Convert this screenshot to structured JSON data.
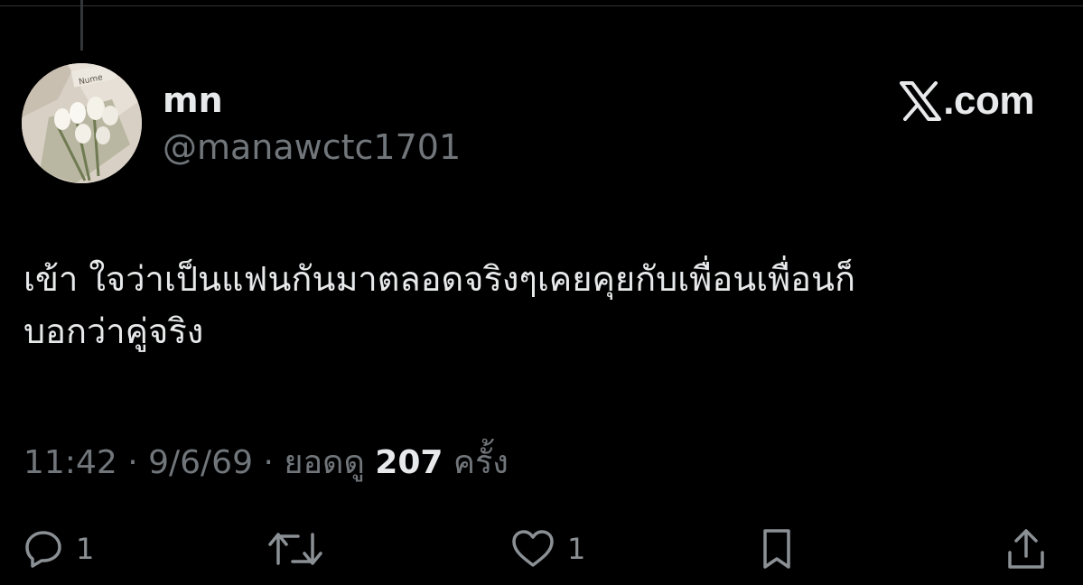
{
  "tweet": {
    "display_name": "mn",
    "handle": "@manawctc1701",
    "brand_text": ".com",
    "text_lines": [
      "เข้า ใจว่าเป็นแฟนกันมาตลอดจริงๆเคยคุยกับเพื่อนเพื่อนก็",
      "บอกว่าคู่จริง"
    ],
    "time": "11:42",
    "separator1": "·",
    "date": "9/6/69",
    "separator2": "·",
    "views_label": "ยอดดู",
    "views_count": "207",
    "views_suffix": "ครั้ง",
    "avatar_label": "Nume",
    "replies_count": "1",
    "likes_count": "1"
  },
  "icons": {
    "brand": "x-logo-icon",
    "reply": "reply-icon",
    "retweet": "retweet-icon",
    "like": "heart-icon",
    "bookmark": "bookmark-icon",
    "share": "share-icon"
  },
  "colors": {
    "background": "#000000",
    "primary_text": "#e7e9ea",
    "secondary_text": "#71767b"
  }
}
